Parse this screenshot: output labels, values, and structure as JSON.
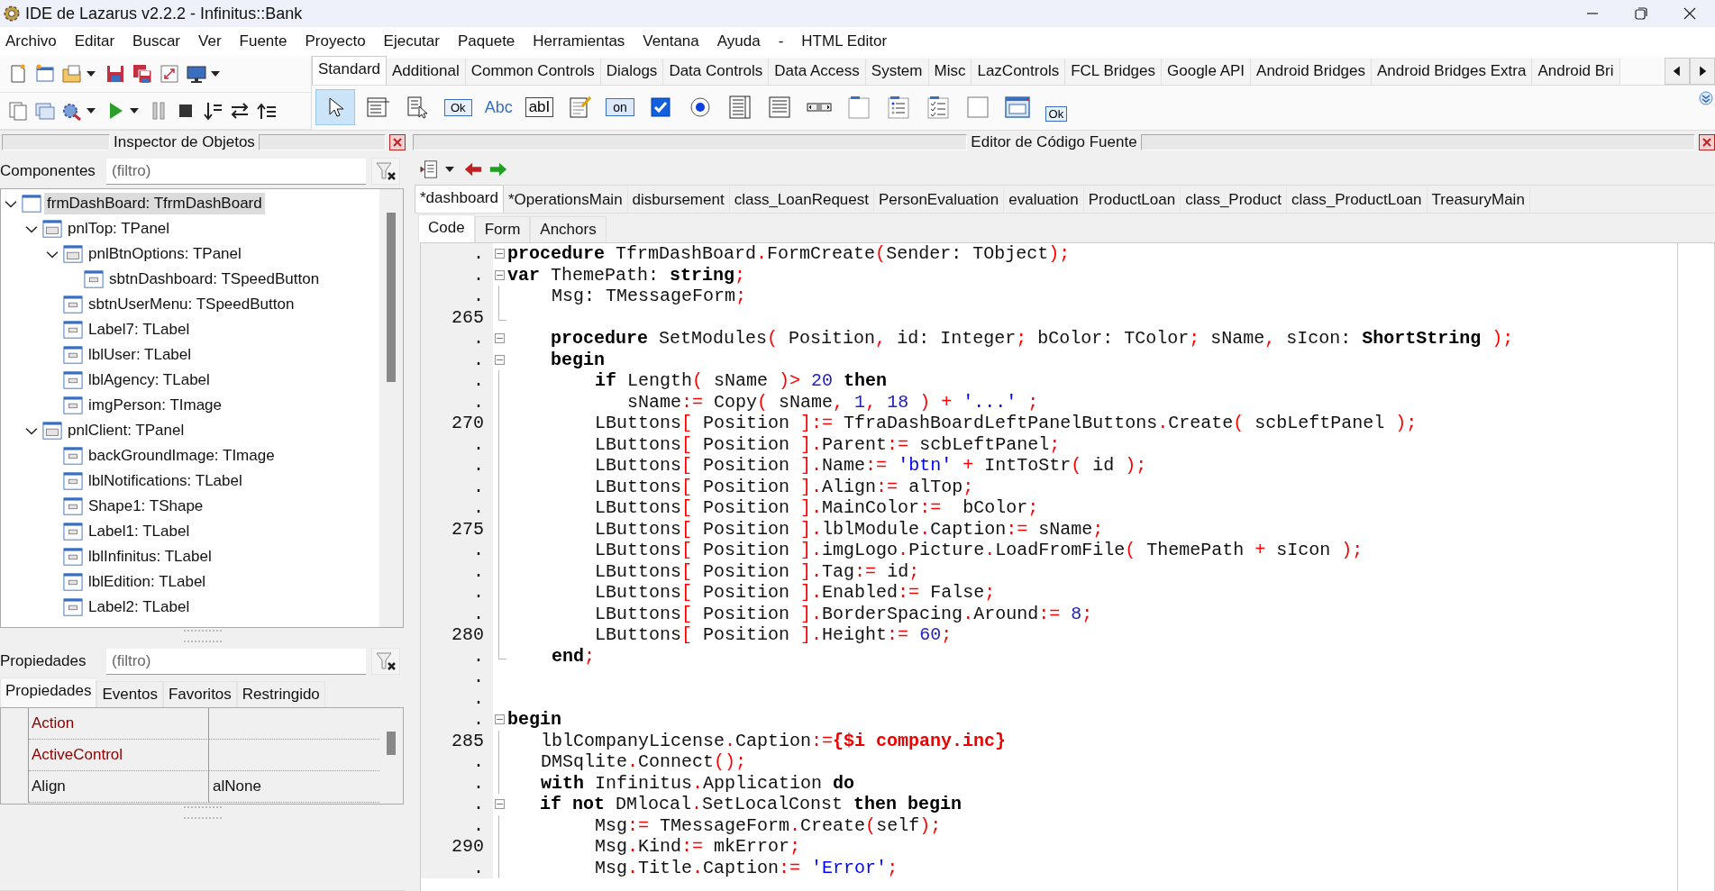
{
  "window": {
    "title": "IDE de Lazarus v2.2.2 - Infinitus::Bank"
  },
  "menu": [
    "Archivo",
    "Editar",
    "Buscar",
    "Ver",
    "Fuente",
    "Proyecto",
    "Ejecutar",
    "Paquete",
    "Herramientas",
    "Ventana",
    "Ayuda",
    "-",
    "HTML Editor"
  ],
  "palette": {
    "tabs": [
      {
        "label": "Standard",
        "selected": true
      },
      {
        "label": "Additional",
        "selected": false
      },
      {
        "label": "Common Controls",
        "selected": false
      },
      {
        "label": "Dialogs",
        "selected": false
      },
      {
        "label": "Data Controls",
        "selected": false
      },
      {
        "label": "Data Access",
        "selected": false
      },
      {
        "label": "System",
        "selected": false
      },
      {
        "label": "Misc",
        "selected": false
      },
      {
        "label": "LazControls",
        "selected": false
      },
      {
        "label": "FCL Bridges",
        "selected": false
      },
      {
        "label": "Google API",
        "selected": false
      },
      {
        "label": "Android Bridges",
        "selected": false
      },
      {
        "label": "Android Bridges Extra",
        "selected": false
      },
      {
        "label": "Android Bri",
        "selected": false
      }
    ],
    "tools": [
      {
        "kind": "pointer",
        "selected": true
      },
      {
        "kind": "mainmenu",
        "selected": false
      },
      {
        "kind": "popupmenu",
        "selected": false
      },
      {
        "kind": "button",
        "label": "Ok",
        "selected": false
      },
      {
        "kind": "label",
        "label": "Abc",
        "selected": false
      },
      {
        "kind": "edit",
        "label": "abI",
        "selected": false
      },
      {
        "kind": "memo",
        "selected": false
      },
      {
        "kind": "toggle",
        "label": "on",
        "selected": false
      },
      {
        "kind": "checkbox",
        "selected": false
      },
      {
        "kind": "radio",
        "selected": false
      },
      {
        "kind": "listbox",
        "selected": false
      },
      {
        "kind": "combobox",
        "selected": false
      },
      {
        "kind": "scrollbar",
        "selected": false
      },
      {
        "kind": "groupbox",
        "selected": false
      },
      {
        "kind": "radiogroup",
        "selected": false
      },
      {
        "kind": "checkgroup",
        "selected": false
      },
      {
        "kind": "panel",
        "selected": false
      },
      {
        "kind": "frame",
        "selected": false
      },
      {
        "kind": "actionlist",
        "label": "Ok",
        "selected": false
      }
    ]
  },
  "inspector": {
    "title": "Inspector de Objetos",
    "components_label": "Componentes",
    "components_filter": {
      "placeholder": "(filtro)"
    },
    "tree": [
      {
        "label": "frmDashBoard: TfrmDashBoard",
        "selected": true,
        "expanded": true,
        "children": [
          {
            "label": "pnlTop: TPanel",
            "selected": false,
            "expanded": true,
            "children": [
              {
                "label": "pnlBtnOptions: TPanel",
                "selected": false,
                "expanded": true,
                "children": [
                  {
                    "label": "sbtnDashboard: TSpeedButton",
                    "selected": false
                  }
                ]
              },
              {
                "label": "sbtnUserMenu: TSpeedButton",
                "selected": false
              },
              {
                "label": "Label7: TLabel",
                "selected": false
              },
              {
                "label": "lblUser: TLabel",
                "selected": false
              },
              {
                "label": "lblAgency: TLabel",
                "selected": false
              },
              {
                "label": "imgPerson: TImage",
                "selected": false
              }
            ]
          },
          {
            "label": "pnlClient: TPanel",
            "selected": false,
            "expanded": true,
            "children": [
              {
                "label": "backGroundImage: TImage",
                "selected": false
              },
              {
                "label": "lblNotifications: TLabel",
                "selected": false
              },
              {
                "label": "Shape1: TShape",
                "selected": false
              },
              {
                "label": "Label1: TLabel",
                "selected": false
              },
              {
                "label": "lblInfinitus: TLabel",
                "selected": false
              },
              {
                "label": "lblEdition: TLabel",
                "selected": false
              },
              {
                "label": "Label2: TLabel",
                "selected": false
              }
            ]
          }
        ]
      }
    ],
    "properties_label": "Propiedades",
    "properties_filter": {
      "placeholder": "(filtro)"
    },
    "tabs": [
      {
        "label": "Propiedades",
        "selected": true
      },
      {
        "label": "Eventos",
        "selected": false
      },
      {
        "label": "Favoritos",
        "selected": false
      },
      {
        "label": "Restringido",
        "selected": false
      }
    ],
    "properties": [
      {
        "name": "Action",
        "kind": "reference"
      },
      {
        "name": "ActiveControl",
        "kind": "reference"
      },
      {
        "name": "Align",
        "kind": "value",
        "value": "alNone"
      }
    ]
  },
  "editor": {
    "title": "Editor de Código Fuente",
    "file_tabs": [
      {
        "label": "*dashboard",
        "selected": true
      },
      {
        "label": "*OperationsMain",
        "selected": false
      },
      {
        "label": "disbursement",
        "selected": false
      },
      {
        "label": "class_LoanRequest",
        "selected": false
      },
      {
        "label": "PersonEvaluation",
        "selected": false
      },
      {
        "label": "evaluation",
        "selected": false
      },
      {
        "label": "ProductLoan",
        "selected": false
      },
      {
        "label": "class_Product",
        "selected": false
      },
      {
        "label": "class_ProductLoan",
        "selected": false
      },
      {
        "label": "TreasuryMain",
        "selected": false
      }
    ],
    "view_tabs": [
      {
        "label": "Code",
        "selected": true
      },
      {
        "label": "Form",
        "selected": false
      },
      {
        "label": "Anchors",
        "selected": false
      }
    ],
    "lines": [
      {
        "gutter": ".",
        "kind": "foldstart",
        "t": [
          {
            "kind": "keyword",
            "text": "procedure"
          },
          {
            "kind": "plain",
            "text": " TfrmDashBoard"
          },
          {
            "kind": "symbol",
            "text": "."
          },
          {
            "kind": "plain",
            "text": "FormCreate"
          },
          {
            "kind": "symbol",
            "text": "("
          },
          {
            "kind": "plain",
            "text": "Sender: TObject"
          },
          {
            "kind": "symbol",
            "text": ");"
          }
        ]
      },
      {
        "gutter": ".",
        "kind": "foldstart",
        "t": [
          {
            "kind": "keyword",
            "text": "var"
          },
          {
            "kind": "plain",
            "text": " ThemePath: "
          },
          {
            "kind": "keyword",
            "text": "string"
          },
          {
            "kind": "symbol",
            "text": ";"
          }
        ]
      },
      {
        "gutter": ".",
        "kind": "foldbody",
        "t": [
          {
            "kind": "plain",
            "text": "    Msg: TMessageForm"
          },
          {
            "kind": "symbol",
            "text": ";"
          }
        ]
      },
      {
        "gutter": "265",
        "kind": "foldend"
      },
      {
        "gutter": ".",
        "kind": "foldstart",
        "t": [
          {
            "kind": "keyword",
            "text": "    procedure"
          },
          {
            "kind": "plain",
            "text": " SetModules"
          },
          {
            "kind": "symbol",
            "text": "("
          },
          {
            "kind": "plain",
            "text": " Position"
          },
          {
            "kind": "symbol",
            "text": ","
          },
          {
            "kind": "plain",
            "text": " id: Integer"
          },
          {
            "kind": "symbol",
            "text": ";"
          },
          {
            "kind": "plain",
            "text": " bColor: TColor"
          },
          {
            "kind": "symbol",
            "text": ";"
          },
          {
            "kind": "plain",
            "text": " sName"
          },
          {
            "kind": "symbol",
            "text": ","
          },
          {
            "kind": "plain",
            "text": " sIcon: "
          },
          {
            "kind": "keyword",
            "text": "ShortString"
          },
          {
            "kind": "symbol",
            "text": " );"
          }
        ]
      },
      {
        "gutter": ".",
        "kind": "foldstart",
        "t": [
          {
            "kind": "keyword",
            "text": "    begin"
          }
        ]
      },
      {
        "gutter": ".",
        "kind": "foldbody",
        "t": [
          {
            "kind": "keyword",
            "text": "        if"
          },
          {
            "kind": "plain",
            "text": " Length"
          },
          {
            "kind": "symbol",
            "text": "("
          },
          {
            "kind": "plain",
            "text": " sName "
          },
          {
            "kind": "symbol",
            "text": ")> "
          },
          {
            "kind": "number",
            "text": "20"
          },
          {
            "kind": "keyword",
            "text": " then"
          }
        ]
      },
      {
        "gutter": ".",
        "kind": "foldbody",
        "t": [
          {
            "kind": "plain",
            "text": "           sName"
          },
          {
            "kind": "symbol",
            "text": ":="
          },
          {
            "kind": "plain",
            "text": " Copy"
          },
          {
            "kind": "symbol",
            "text": "("
          },
          {
            "kind": "plain",
            "text": " sName"
          },
          {
            "kind": "symbol",
            "text": ","
          },
          {
            "kind": "number",
            "text": " 1"
          },
          {
            "kind": "symbol",
            "text": ","
          },
          {
            "kind": "number",
            "text": " 18"
          },
          {
            "kind": "symbol",
            "text": " ) +"
          },
          {
            "kind": "string",
            "text": " '...'"
          },
          {
            "kind": "symbol",
            "text": " ;"
          }
        ]
      },
      {
        "gutter": "270",
        "kind": "foldbody",
        "t": [
          {
            "kind": "plain",
            "text": "        LButtons"
          },
          {
            "kind": "symbol",
            "text": "["
          },
          {
            "kind": "plain",
            "text": " Position "
          },
          {
            "kind": "symbol",
            "text": "]:="
          },
          {
            "kind": "plain",
            "text": " TfraDashBoardLeftPanelButtons"
          },
          {
            "kind": "symbol",
            "text": "."
          },
          {
            "kind": "plain",
            "text": "Create"
          },
          {
            "kind": "symbol",
            "text": "("
          },
          {
            "kind": "plain",
            "text": " scbLeftPanel "
          },
          {
            "kind": "symbol",
            "text": ");"
          }
        ]
      },
      {
        "gutter": ".",
        "kind": "foldbody",
        "t": [
          {
            "kind": "plain",
            "text": "        LButtons"
          },
          {
            "kind": "symbol",
            "text": "["
          },
          {
            "kind": "plain",
            "text": " Position "
          },
          {
            "kind": "symbol",
            "text": "]."
          },
          {
            "kind": "plain",
            "text": "Parent"
          },
          {
            "kind": "symbol",
            "text": ":="
          },
          {
            "kind": "plain",
            "text": " scbLeftPanel"
          },
          {
            "kind": "symbol",
            "text": ";"
          }
        ]
      },
      {
        "gutter": ".",
        "kind": "foldbody",
        "t": [
          {
            "kind": "plain",
            "text": "        LButtons"
          },
          {
            "kind": "symbol",
            "text": "["
          },
          {
            "kind": "plain",
            "text": " Position "
          },
          {
            "kind": "symbol",
            "text": "]."
          },
          {
            "kind": "plain",
            "text": "Name"
          },
          {
            "kind": "symbol",
            "text": ":="
          },
          {
            "kind": "string",
            "text": " 'btn'"
          },
          {
            "kind": "symbol",
            "text": " +"
          },
          {
            "kind": "plain",
            "text": " IntToStr"
          },
          {
            "kind": "symbol",
            "text": "("
          },
          {
            "kind": "plain",
            "text": " id "
          },
          {
            "kind": "symbol",
            "text": ");"
          }
        ]
      },
      {
        "gutter": ".",
        "kind": "foldbody",
        "t": [
          {
            "kind": "plain",
            "text": "        LButtons"
          },
          {
            "kind": "symbol",
            "text": "["
          },
          {
            "kind": "plain",
            "text": " Position "
          },
          {
            "kind": "symbol",
            "text": "]."
          },
          {
            "kind": "plain",
            "text": "Align"
          },
          {
            "kind": "symbol",
            "text": ":="
          },
          {
            "kind": "plain",
            "text": " alTop"
          },
          {
            "kind": "symbol",
            "text": ";"
          }
        ]
      },
      {
        "gutter": ".",
        "kind": "foldbody",
        "t": [
          {
            "kind": "plain",
            "text": "        LButtons"
          },
          {
            "kind": "symbol",
            "text": "["
          },
          {
            "kind": "plain",
            "text": " Position "
          },
          {
            "kind": "symbol",
            "text": "]."
          },
          {
            "kind": "plain",
            "text": "MainColor"
          },
          {
            "kind": "symbol",
            "text": ":="
          },
          {
            "kind": "plain",
            "text": "  bColor"
          },
          {
            "kind": "symbol",
            "text": ";"
          }
        ]
      },
      {
        "gutter": "275",
        "kind": "foldbody",
        "t": [
          {
            "kind": "plain",
            "text": "        LButtons"
          },
          {
            "kind": "symbol",
            "text": "["
          },
          {
            "kind": "plain",
            "text": " Position "
          },
          {
            "kind": "symbol",
            "text": "]."
          },
          {
            "kind": "plain",
            "text": "lblModule"
          },
          {
            "kind": "symbol",
            "text": "."
          },
          {
            "kind": "plain",
            "text": "Caption"
          },
          {
            "kind": "symbol",
            "text": ":="
          },
          {
            "kind": "plain",
            "text": " sName"
          },
          {
            "kind": "symbol",
            "text": ";"
          }
        ]
      },
      {
        "gutter": ".",
        "kind": "foldbody",
        "t": [
          {
            "kind": "plain",
            "text": "        LButtons"
          },
          {
            "kind": "symbol",
            "text": "["
          },
          {
            "kind": "plain",
            "text": " Position "
          },
          {
            "kind": "symbol",
            "text": "]."
          },
          {
            "kind": "plain",
            "text": "imgLogo"
          },
          {
            "kind": "symbol",
            "text": "."
          },
          {
            "kind": "plain",
            "text": "Picture"
          },
          {
            "kind": "symbol",
            "text": "."
          },
          {
            "kind": "plain",
            "text": "LoadFromFile"
          },
          {
            "kind": "symbol",
            "text": "("
          },
          {
            "kind": "plain",
            "text": " ThemePath "
          },
          {
            "kind": "symbol",
            "text": "+"
          },
          {
            "kind": "plain",
            "text": " sIcon "
          },
          {
            "kind": "symbol",
            "text": ");"
          }
        ]
      },
      {
        "gutter": ".",
        "kind": "foldbody",
        "t": [
          {
            "kind": "plain",
            "text": "        LButtons"
          },
          {
            "kind": "symbol",
            "text": "["
          },
          {
            "kind": "plain",
            "text": " Position "
          },
          {
            "kind": "symbol",
            "text": "]."
          },
          {
            "kind": "plain",
            "text": "Tag"
          },
          {
            "kind": "symbol",
            "text": ":="
          },
          {
            "kind": "plain",
            "text": " id"
          },
          {
            "kind": "symbol",
            "text": ";"
          }
        ]
      },
      {
        "gutter": ".",
        "kind": "foldbody",
        "t": [
          {
            "kind": "plain",
            "text": "        LButtons"
          },
          {
            "kind": "symbol",
            "text": "["
          },
          {
            "kind": "plain",
            "text": " Position "
          },
          {
            "kind": "symbol",
            "text": "]."
          },
          {
            "kind": "plain",
            "text": "Enabled"
          },
          {
            "kind": "symbol",
            "text": ":="
          },
          {
            "kind": "plain",
            "text": " False"
          },
          {
            "kind": "symbol",
            "text": ";"
          }
        ]
      },
      {
        "gutter": ".",
        "kind": "foldbody",
        "t": [
          {
            "kind": "plain",
            "text": "        LButtons"
          },
          {
            "kind": "symbol",
            "text": "["
          },
          {
            "kind": "plain",
            "text": " Position "
          },
          {
            "kind": "symbol",
            "text": "]."
          },
          {
            "kind": "plain",
            "text": "BorderSpacing"
          },
          {
            "kind": "symbol",
            "text": "."
          },
          {
            "kind": "plain",
            "text": "Around"
          },
          {
            "kind": "symbol",
            "text": ":="
          },
          {
            "kind": "number",
            "text": " 8"
          },
          {
            "kind": "symbol",
            "text": ";"
          }
        ]
      },
      {
        "gutter": "280",
        "kind": "foldbody",
        "t": [
          {
            "kind": "plain",
            "text": "        LButtons"
          },
          {
            "kind": "symbol",
            "text": "["
          },
          {
            "kind": "plain",
            "text": " Position "
          },
          {
            "kind": "symbol",
            "text": "]."
          },
          {
            "kind": "plain",
            "text": "Height"
          },
          {
            "kind": "symbol",
            "text": ":="
          },
          {
            "kind": "number",
            "text": " 60"
          },
          {
            "kind": "symbol",
            "text": ";"
          }
        ]
      },
      {
        "gutter": ".",
        "kind": "foldend",
        "t": [
          {
            "kind": "keyword",
            "text": "    end"
          },
          {
            "kind": "symbol",
            "text": ";"
          }
        ]
      },
      {
        "gutter": ".",
        "kind": "plain"
      },
      {
        "gutter": ".",
        "kind": "plain"
      },
      {
        "gutter": ".",
        "kind": "foldstart",
        "t": [
          {
            "kind": "keyword",
            "text": "begin"
          }
        ]
      },
      {
        "gutter": "285",
        "kind": "foldbody",
        "t": [
          {
            "kind": "plain",
            "text": "   lblCompanyLicense"
          },
          {
            "kind": "symbol",
            "text": "."
          },
          {
            "kind": "plain",
            "text": "Caption"
          },
          {
            "kind": "symbol",
            "text": ":="
          },
          {
            "kind": "directive",
            "text": "{$i company.inc}"
          }
        ]
      },
      {
        "gutter": ".",
        "kind": "foldbody",
        "t": [
          {
            "kind": "plain",
            "text": "   DMSqlite"
          },
          {
            "kind": "symbol",
            "text": "."
          },
          {
            "kind": "plain",
            "text": "Connect"
          },
          {
            "kind": "symbol",
            "text": "();"
          }
        ]
      },
      {
        "gutter": ".",
        "kind": "foldbody",
        "t": [
          {
            "kind": "keyword",
            "text": "   with"
          },
          {
            "kind": "plain",
            "text": " Infinitus"
          },
          {
            "kind": "symbol",
            "text": "."
          },
          {
            "kind": "plain",
            "text": "Application "
          },
          {
            "kind": "keyword",
            "text": "do"
          }
        ]
      },
      {
        "gutter": ".",
        "kind": "foldstart",
        "t": [
          {
            "kind": "keyword",
            "text": "   if not"
          },
          {
            "kind": "plain",
            "text": " DMlocal"
          },
          {
            "kind": "symbol",
            "text": "."
          },
          {
            "kind": "plain",
            "text": "SetLocalConst "
          },
          {
            "kind": "keyword",
            "text": "then begin"
          }
        ]
      },
      {
        "gutter": ".",
        "kind": "foldbody",
        "t": [
          {
            "kind": "plain",
            "text": "        Msg"
          },
          {
            "kind": "symbol",
            "text": ":="
          },
          {
            "kind": "plain",
            "text": " TMessageForm"
          },
          {
            "kind": "symbol",
            "text": "."
          },
          {
            "kind": "plain",
            "text": "Create"
          },
          {
            "kind": "symbol",
            "text": "("
          },
          {
            "kind": "plain",
            "text": "self"
          },
          {
            "kind": "symbol",
            "text": ");"
          }
        ]
      },
      {
        "gutter": "290",
        "kind": "foldbody",
        "t": [
          {
            "kind": "plain",
            "text": "        Msg"
          },
          {
            "kind": "symbol",
            "text": "."
          },
          {
            "kind": "plain",
            "text": "Kind"
          },
          {
            "kind": "symbol",
            "text": ":="
          },
          {
            "kind": "plain",
            "text": " mkError"
          },
          {
            "kind": "symbol",
            "text": ";"
          }
        ]
      },
      {
        "gutter": ".",
        "kind": "foldbody",
        "t": [
          {
            "kind": "plain",
            "text": "        Msg"
          },
          {
            "kind": "symbol",
            "text": "."
          },
          {
            "kind": "plain",
            "text": "Title"
          },
          {
            "kind": "symbol",
            "text": "."
          },
          {
            "kind": "plain",
            "text": "Caption"
          },
          {
            "kind": "symbol",
            "text": ":="
          },
          {
            "kind": "string",
            "text": " 'Error'"
          },
          {
            "kind": "symbol",
            "text": ";"
          }
        ]
      }
    ]
  }
}
